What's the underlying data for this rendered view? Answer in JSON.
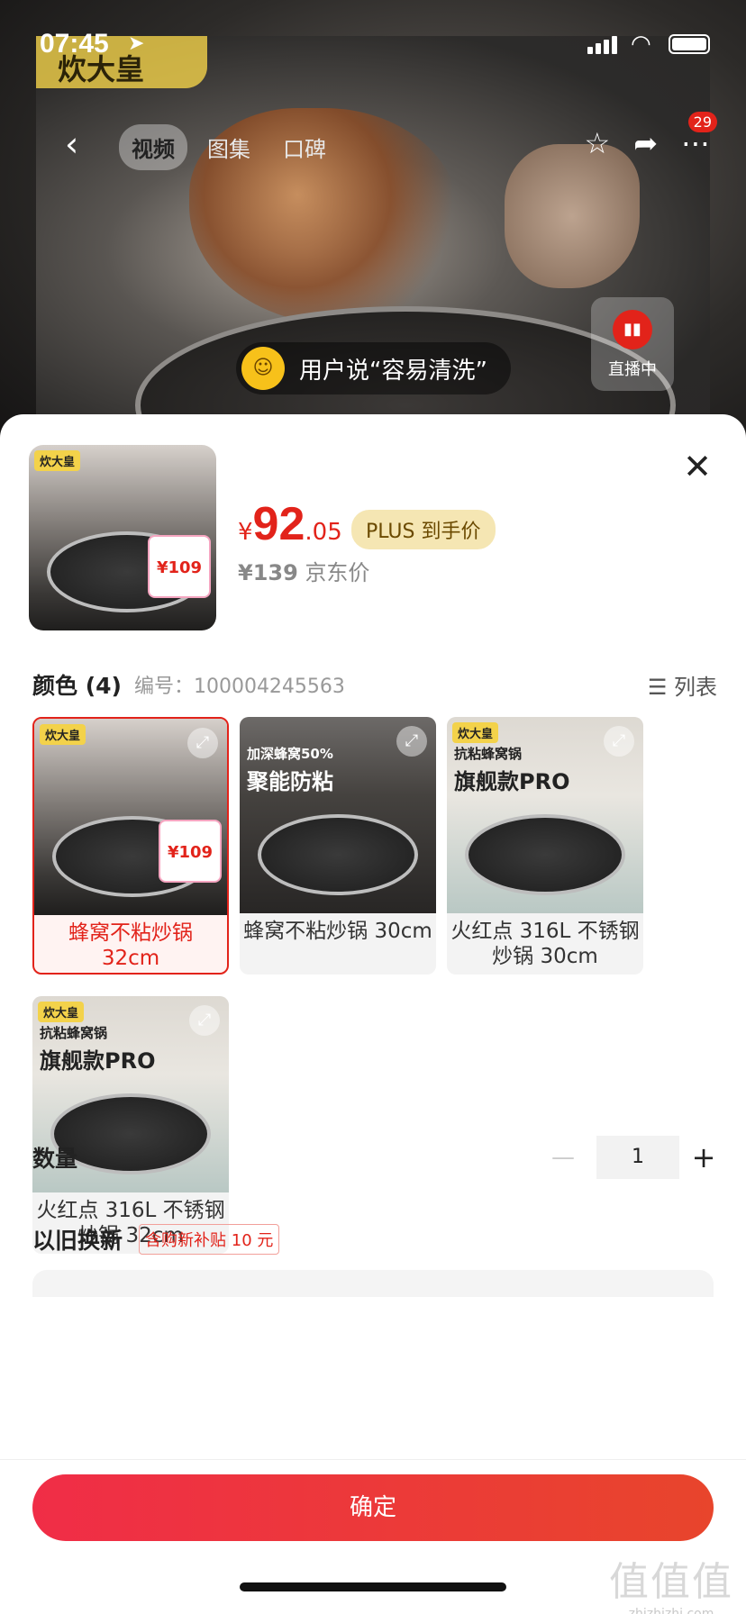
{
  "status_bar": {
    "time": "07:45"
  },
  "header": {
    "brand_overlay": "炊大皇",
    "tabs": [
      {
        "label": "视频",
        "active": true
      },
      {
        "label": "图集",
        "active": false
      },
      {
        "label": "口碑",
        "active": false
      }
    ],
    "message_badge": "29",
    "live_label": "直播中",
    "review_banner": "用户说“容易清洗”"
  },
  "product": {
    "main_price_symbol": "¥",
    "main_price_int": "92",
    "main_price_dec": ".05",
    "plus_label": "PLUS 到手价",
    "original_price": "¥139",
    "original_label": "京东价",
    "thumb_price": "¥109",
    "thumb_brand": "炊大皇"
  },
  "options": {
    "title": "颜色 (4)",
    "sku_label": "编号：100004245563",
    "list_toggle": "列表",
    "items": [
      {
        "label": "蜂窝不粘炒锅 32cm",
        "selected": true,
        "brand": "炊大皇",
        "price_tag": "¥109",
        "head1": "",
        "head2": ""
      },
      {
        "label": "蜂窝不粘炒锅 30cm",
        "selected": false,
        "brand": "",
        "head1": "加深蜂窝50%",
        "head2": "聚能防粘"
      },
      {
        "label": "火红点 316L 不锈钢炒锅 30cm",
        "selected": false,
        "brand": "炊大皇",
        "head1": "抗粘蜂窝锅",
        "head2": "旗舰款PRO"
      },
      {
        "label": "火红点 316L 不锈钢炒锅 32cm",
        "selected": false,
        "brand": "炊大皇",
        "head1": "抗粘蜂窝锅",
        "head2": "旗舰款PRO"
      }
    ]
  },
  "quantity": {
    "label": "数量",
    "value": "1",
    "minus": "—",
    "plus": "+"
  },
  "trade_in": {
    "label": "以旧换新",
    "subsidy": "含购新补贴 10 元"
  },
  "footer": {
    "confirm_label": "确定"
  },
  "watermark": {
    "big": "值值值",
    "url": "zhizhizhi.com"
  },
  "colors": {
    "accent": "#e2231a",
    "button_start": "#f02d47",
    "button_end": "#e8452c"
  }
}
